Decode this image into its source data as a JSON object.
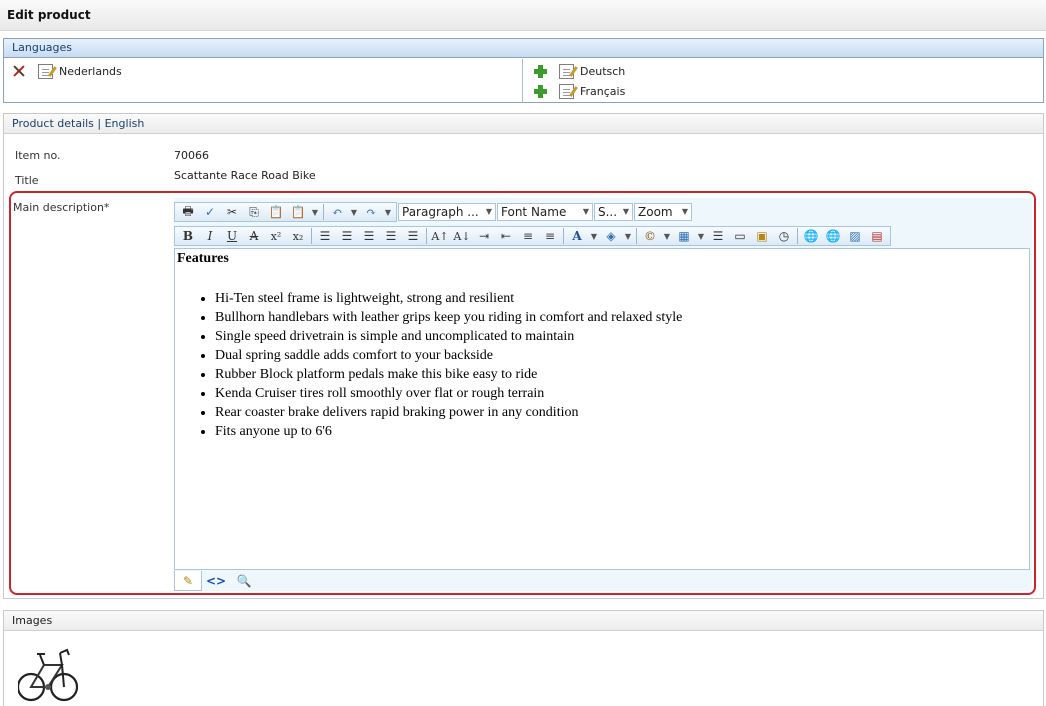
{
  "page": {
    "title": "Edit product"
  },
  "languages": {
    "header": "Languages",
    "existing": [
      {
        "name": "Nederlands"
      }
    ],
    "available": [
      {
        "name": "Deutsch"
      },
      {
        "name": "Français"
      }
    ]
  },
  "product_details": {
    "header": "Product details | English",
    "item_no_label": "Item no.",
    "item_no_value": "70066",
    "title_label": "Title",
    "title_value": "Scattante Race Road Bike",
    "description_label": "Main description*"
  },
  "editor": {
    "toolbar": {
      "paragraph_select": "Paragraph ...",
      "font_select": "Font Name",
      "size_select": "S...",
      "zoom_select": "Zoom"
    },
    "content": {
      "heading": "Features",
      "bullets": [
        "Hi-Ten steel frame is lightweight, strong and resilient",
        "Bullhorn handlebars with leather grips keep you riding in comfort and relaxed style",
        "Single speed drivetrain is simple and uncomplicated to maintain",
        "Dual spring saddle adds comfort to your backside",
        "Rubber Block platform pedals make this bike easy to ride",
        "Kenda Cruiser tires roll smoothly over flat or rough terrain",
        "Rear coaster brake delivers rapid braking power in any condition",
        "Fits anyone up to 6'6"
      ]
    }
  },
  "images": {
    "header": "Images"
  },
  "colors": {
    "accent": "#c8262d",
    "panel_border": "#8aa3b8",
    "header_text": "#1c3f66"
  }
}
